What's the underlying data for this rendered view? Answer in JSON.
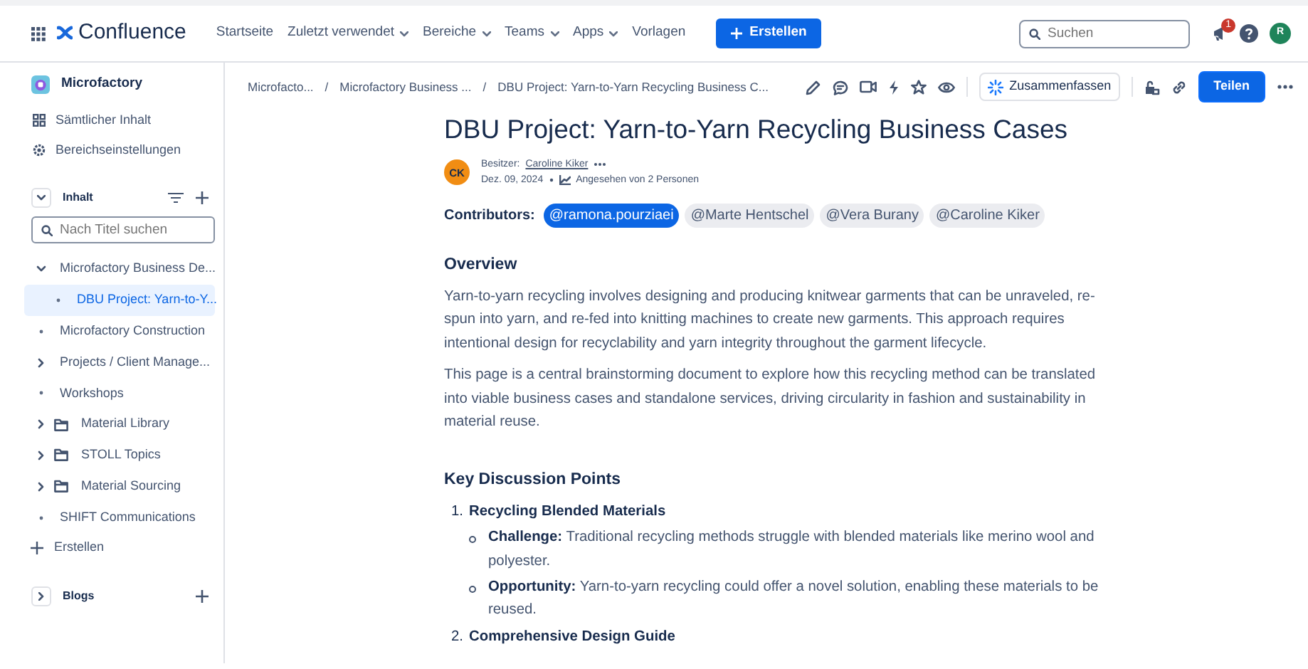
{
  "topbar": {
    "product": "Confluence",
    "nav": [
      {
        "label": "Startseite",
        "dropdown": false
      },
      {
        "label": "Zuletzt verwendet",
        "dropdown": true
      },
      {
        "label": "Bereiche",
        "dropdown": true
      },
      {
        "label": "Teams",
        "dropdown": true
      },
      {
        "label": "Apps",
        "dropdown": true
      },
      {
        "label": "Vorlagen",
        "dropdown": false
      }
    ],
    "create_button": "Erstellen",
    "search": {
      "placeholder": "Suchen"
    },
    "notification_count": "1",
    "avatar_initial": "R"
  },
  "sidebar": {
    "space_name": "Microfactory",
    "links": [
      "Sämtlicher Inhalt",
      "Bereichseinstellungen"
    ],
    "content_heading": "Inhalt",
    "filter": {
      "placeholder": "Nach Titel suchen"
    },
    "tree": [
      {
        "label": "Microfactory Business De...",
        "kind": "page",
        "expandable": true,
        "expanded": true,
        "selected": false,
        "children": [
          {
            "label": "DBU Project: Yarn-to-Y...",
            "kind": "page",
            "expandable": false,
            "selected": true
          }
        ]
      },
      {
        "label": "Microfactory Construction",
        "kind": "page",
        "expandable": false,
        "selected": false
      },
      {
        "label": "Projects / Client Manage...",
        "kind": "page",
        "expandable": true,
        "expanded": false,
        "selected": false
      },
      {
        "label": "Workshops",
        "kind": "page",
        "expandable": false,
        "selected": false
      },
      {
        "label": "Material Library",
        "kind": "folder",
        "expandable": true,
        "expanded": false,
        "selected": false
      },
      {
        "label": "STOLL Topics",
        "kind": "folder",
        "expandable": true,
        "expanded": false,
        "selected": false
      },
      {
        "label": "Material Sourcing",
        "kind": "folder",
        "expandable": true,
        "expanded": false,
        "selected": false
      },
      {
        "label": "SHIFT Communications",
        "kind": "page",
        "expandable": false,
        "selected": false
      }
    ],
    "create_label": "Erstellen",
    "blogs_heading": "Blogs"
  },
  "breadcrumb_separator": "/",
  "breadcrumbs": [
    "Microfacto...",
    "Microfactory Business ...",
    "DBU Project: Yarn-to-Yarn Recycling Business C..."
  ],
  "toolbar": {
    "summarize_button": "Zusammenfassen",
    "share_button": "Teilen"
  },
  "page": {
    "title": "DBU Project: Yarn-to-Yarn Recycling Business Cases",
    "owner_initials": "CK",
    "owner_label": "Besitzer:",
    "owner_name": "Caroline Kiker",
    "date": "Dez. 09, 2024",
    "views": "Angesehen von 2 Personen",
    "contributors_label": "Contributors:",
    "contributors": [
      {
        "label": "@ramona.pourziaei",
        "highlighted": true
      },
      {
        "label": "@Marte Hentschel",
        "highlighted": false
      },
      {
        "label": "@Vera Burany",
        "highlighted": false
      },
      {
        "label": "@Caroline Kiker",
        "highlighted": false
      }
    ],
    "sections": [
      {
        "heading": "Overview",
        "paragraphs": [
          "Yarn-to-yarn recycling involves designing and producing knitwear garments that can be unraveled, re-spun into yarn, and re-fed into knitting machines to create new garments. This approach requires intentional design for recyclability and yarn integrity throughout the garment lifecycle.",
          "This page is a central brainstorming document to explore how this recycling method can be translated into viable business cases and standalone services, driving circularity in fashion and sustainability in material reuse."
        ]
      },
      {
        "heading": "Key Discussion Points",
        "list": [
          {
            "number": "1.",
            "title": "Recycling Blended Materials",
            "points": [
              "**Challenge:** Traditional recycling methods struggle with blended materials like merino wool and polyester.",
              "**Opportunity:** Yarn-to-yarn recycling could offer a novel solution, enabling these materials to be reused."
            ]
          },
          {
            "number": "2.",
            "title": "Comprehensive Design Guide"
          }
        ]
      }
    ]
  }
}
